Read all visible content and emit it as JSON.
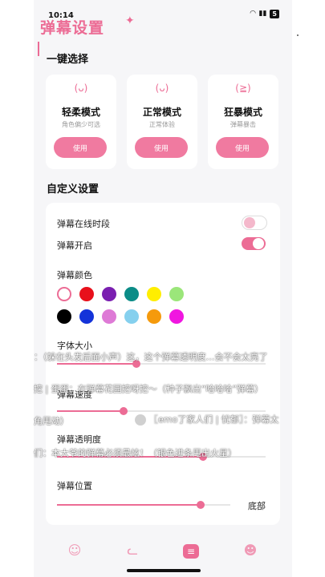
{
  "status_bar": {
    "time": "10:14",
    "battery": "5"
  },
  "header": {
    "title": "弹幕设置",
    "sparkle": "✦"
  },
  "quick_select": {
    "title": "一键选择",
    "modes": [
      {
        "name": "轻柔模式",
        "desc": "角色偏少可选",
        "button": "使用",
        "face": "(ᴗ)"
      },
      {
        "name": "正常模式",
        "desc": "正常体验",
        "button": "使用",
        "face": "(ᴗ)"
      },
      {
        "name": "狂暴模式",
        "desc": "弹幕暴击",
        "button": "使用",
        "face": "(≧)"
      }
    ]
  },
  "custom": {
    "title": "自定义设置",
    "online_period_label": "弹幕在线时段",
    "online_period_on": false,
    "enable_label": "弹幕开启",
    "enable_on": true,
    "color_label": "弹幕颜色",
    "colors_row1": [
      "#ffffff",
      "#e8101b",
      "#7a1fb0",
      "#0b8c87",
      "#ffee00",
      "#9be67a"
    ],
    "colors_row2": [
      "#000000",
      "#1433d9",
      "#de7ad6",
      "#85d0ee",
      "#f59a0c",
      "#f016e0"
    ],
    "font_size_label": "字体大小",
    "font_size_value": 0.38,
    "speed_label": "弹幕速度",
    "speed_value": 0.32,
    "opacity_label": "弹幕透明度",
    "opacity_value": 0.7,
    "position_label": "弹幕位置",
    "position_value": 0.83,
    "position_text": "底部"
  },
  "danmaku": [
    "：（躲在头发后面小声）这，这个弹幕透明度…会不会太亮了",
    "挖 | 蛋蛋：在弹幕花园挖呀挖～（种子飘出“哈哈哈”弹幕）",
    "角甩动）",
    "〖emo了家人们 | 忧郁〗：弹幕太",
    "们：本大爷的弹幕必须最炫！（银色进条甩出火星）"
  ],
  "tabs": [
    {
      "icon": "smile-icon",
      "glyph": "☺",
      "active": false
    },
    {
      "icon": "cat-icon",
      "glyph": "ᓚ",
      "active": false
    },
    {
      "icon": "message-icon",
      "glyph": "≡",
      "active": true
    },
    {
      "icon": "face-icon",
      "glyph": "☻",
      "active": false
    }
  ]
}
